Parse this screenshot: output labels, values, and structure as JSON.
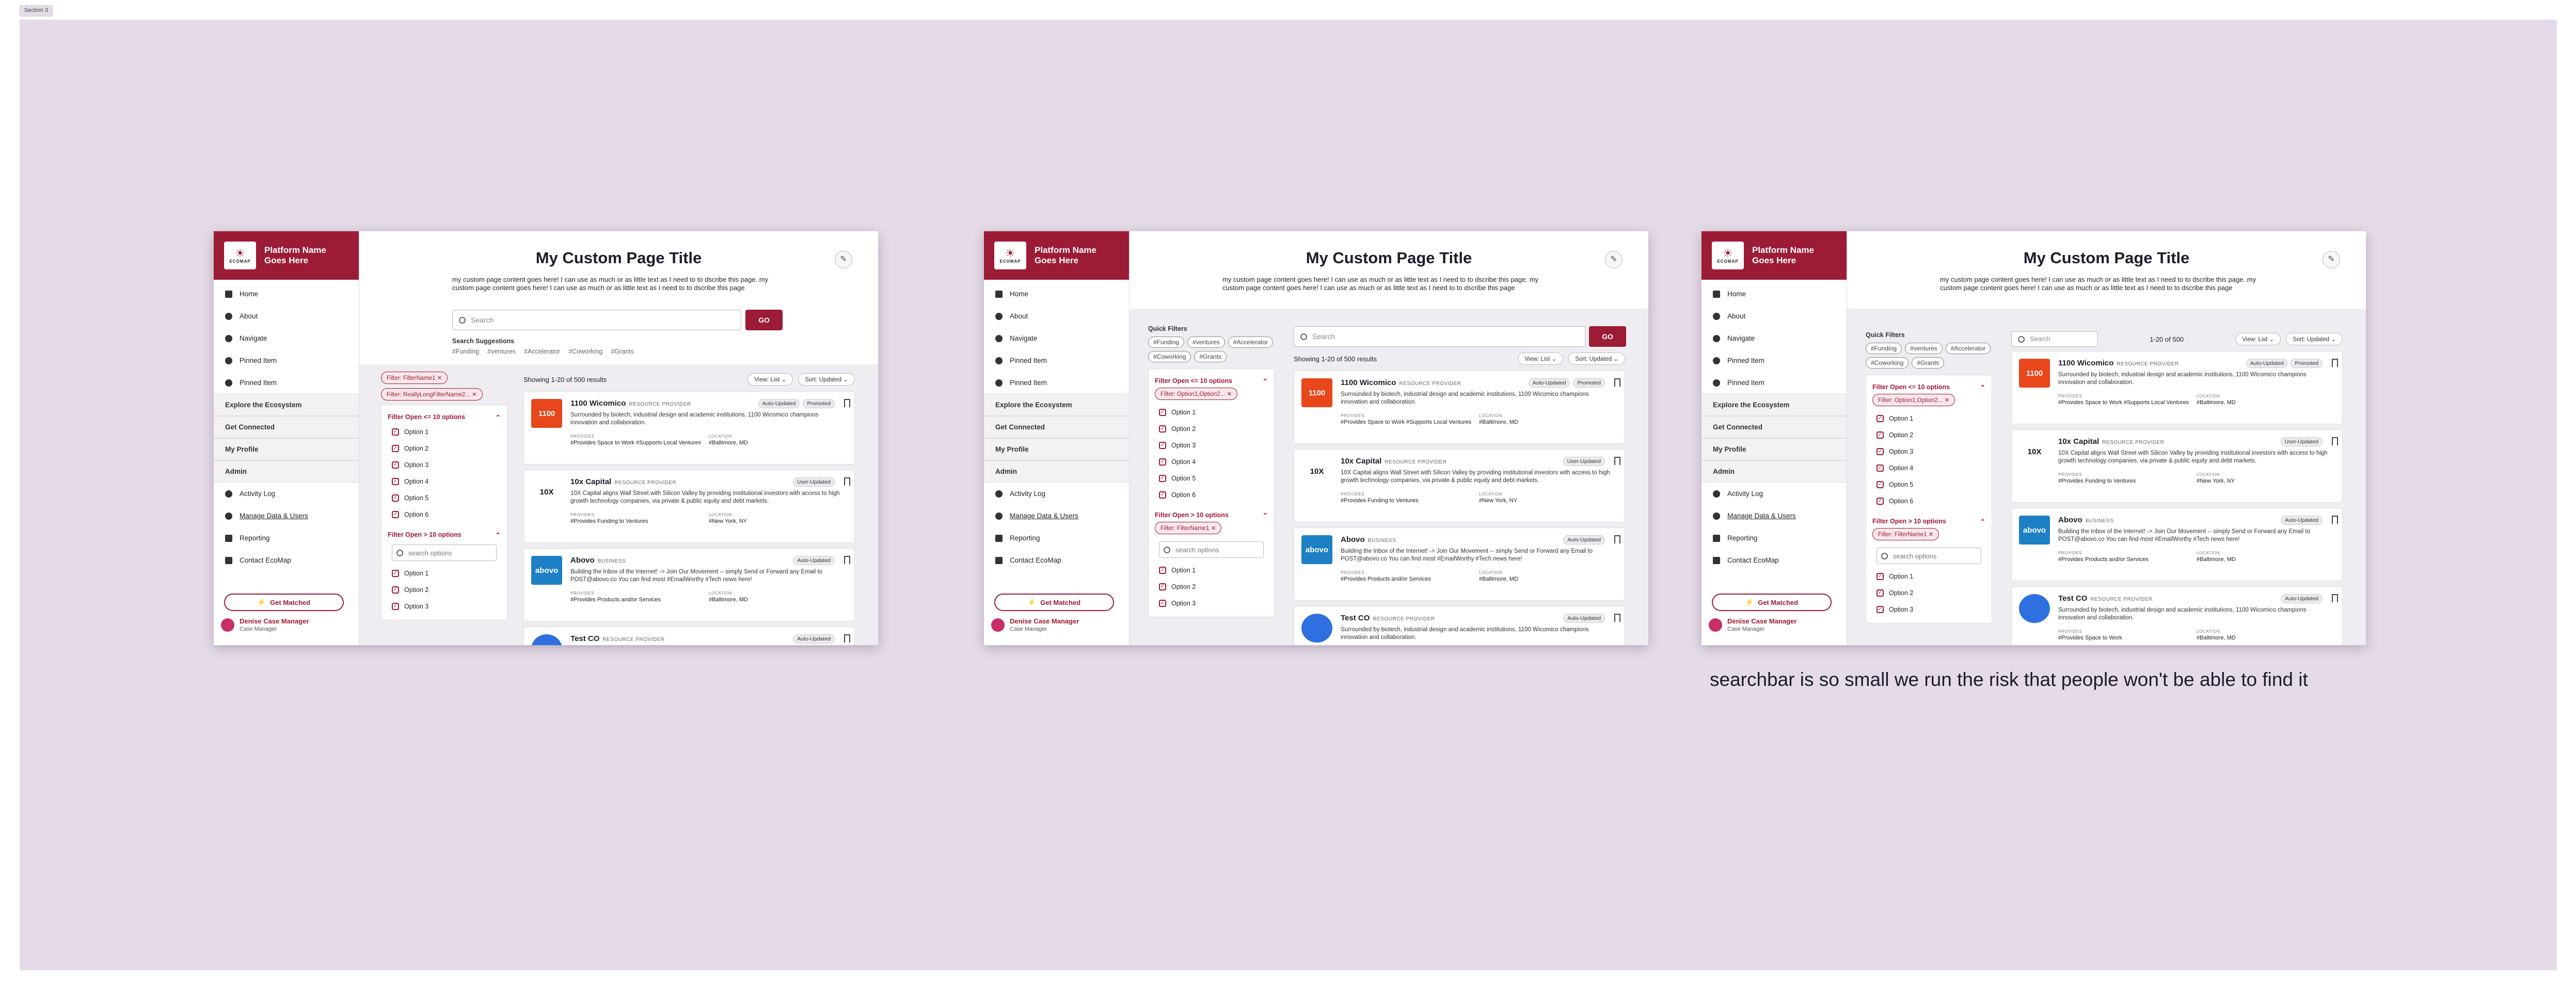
{
  "section_label": "Section 3",
  "comment": "searchbar is so small we run the risk that people won't be able to find it",
  "colors": {
    "brand": "#9c1b35",
    "canvas": "#e5dbe8",
    "avatar": "#c72e6a"
  },
  "sidebar": {
    "brand_line1": "Platform Name",
    "brand_line2": "Goes Here",
    "logo_text": "ECOMAP",
    "nav": [
      {
        "label": "Home",
        "icon": "home-icon"
      },
      {
        "label": "About",
        "icon": "info-icon"
      },
      {
        "label": "Navigate",
        "icon": "compass-icon"
      },
      {
        "label": "Pinned Item",
        "icon": "pin-icon"
      },
      {
        "label": "Pinned Item",
        "icon": "pin-icon"
      }
    ],
    "sections": [
      "Explore the Ecosystem",
      "Get Connected",
      "My Profile",
      "Admin"
    ],
    "admin_nav": [
      {
        "label": "Activity Log",
        "icon": "clock-icon"
      },
      {
        "label": "Manage Data & Users",
        "icon": "users-icon"
      },
      {
        "label": "Reporting",
        "icon": "chart-icon"
      },
      {
        "label": "Contact EcoMap",
        "icon": "mail-icon"
      }
    ],
    "get_matched": "Get Matched",
    "user_name": "Denise Case Manager",
    "user_role": "Case Manager"
  },
  "page": {
    "title": "My Custom Page Title",
    "description": "my custom page content goes here! I can use as much or as little text as I need to to dscribe this page. my custom page content goes here! I can use as much or as little text as I need to to dscribe this page",
    "search_placeholder": "Search",
    "go": "GO",
    "suggestions_title": "Search Suggestions",
    "quick_filters_title": "Quick Filters",
    "tags": [
      "#Funding",
      "#ventures",
      "#Accelerator",
      "#Coworking",
      "#Grants"
    ]
  },
  "filters": {
    "chips_v1": [
      "Filter: FilterName1",
      "Filter: ReallyLongFilterName2..."
    ],
    "chip_v2a": "Filter: Option1,Option2...",
    "chip_v2b": "Filter: FilterName1",
    "group1": "Filter Open <= 10 options",
    "group2": "Filter Open > 10 options",
    "options": [
      "Option 1",
      "Option 2",
      "Option 3",
      "Option 4",
      "Option 5",
      "Option 6"
    ],
    "search_options": "search options",
    "options2": [
      "Option 1",
      "Option 2",
      "Option 3"
    ]
  },
  "results": {
    "count_text": "Showing 1-20 of 500 results",
    "count_short": "1-20 of 500",
    "view": "View: List",
    "sort": "Sort: Updated",
    "search_placeholder": "Search",
    "provides_label": "PROVIDES",
    "location_label": "LOCATION",
    "cards": [
      {
        "name": "1100 Wicomico",
        "type": "RESOURCE PROVIDER",
        "tag1": "Auto-Updated",
        "tag2": "Promoted",
        "logo": "1100",
        "logo_bg": "#e8461b",
        "logo_fg": "#ffffff",
        "desc": "Surrounded by biotech, industrial design and academic institutions, 1100 Wicomico champions innovation and collaboration.",
        "provides": "#Provides Space to Work  #Supports Local Ventures",
        "location": "#Baltimore, MD"
      },
      {
        "name": "10x Capital",
        "type": "RESOURCE PROVIDER",
        "tag1": "User-Updated",
        "tag2": "",
        "logo": "10X",
        "logo_bg": "#ffffff",
        "logo_fg": "#111111",
        "desc": "10X Capital aligns Wall Street with Silicon Valley by providing institutional investors with access to high growth technology companies, via private & public equity and debt markets.",
        "provides": "#Provides Funding to Ventures",
        "location": "#New York, NY"
      },
      {
        "name": "Abovo",
        "type": "BUSINESS",
        "tag1": "Auto-Updated",
        "tag2": "",
        "logo": "abovo",
        "logo_bg": "#1d7fc4",
        "logo_fg": "#ffffff",
        "desc": "Building the Inbox of the Internet! -> Join Our Movement -- simply Send or Forward any Email to POST@abovo.co You can find most #EmailWorthy #Tech news here!",
        "provides": "#Provides Products and/or Services",
        "location": "#Baltimore, MD"
      },
      {
        "name": "Test CO",
        "type": "RESOURCE PROVIDER",
        "tag1": "Auto-Updated",
        "tag2": "",
        "logo": "",
        "logo_bg": "#2f6fe0",
        "logo_fg": "#ffffff",
        "desc": "Surrounded by biotech, industrial design and academic institutions, 1100 Wicomico champions innovation and collaboration.",
        "provides": "#Provides Space to Work",
        "location": "#Baltimore, MD"
      }
    ]
  }
}
